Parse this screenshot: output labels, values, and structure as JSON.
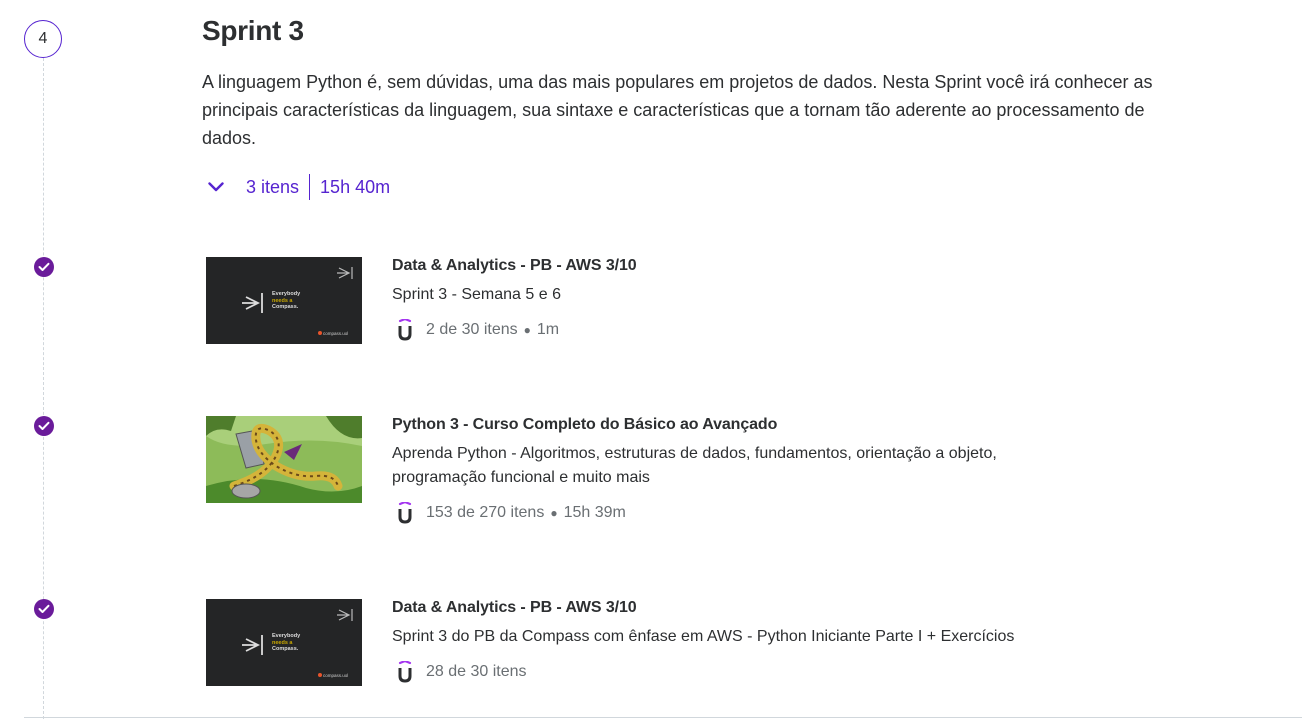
{
  "section": {
    "step_number": "4",
    "title": "Sprint 3",
    "description": "A linguagem Python é, sem dúvidas, uma das mais populares em projetos de dados. Nesta Sprint você irá conhecer as principais características da linguagem, sua sintaxe e características que a tornam tão aderente ao processamento de dados.",
    "item_count": "3 itens",
    "duration": "15h 40m"
  },
  "courses": [
    {
      "title": "Data & Analytics - PB - AWS 3/10",
      "subtitle": "Sprint 3 - Semana 5 e 6",
      "progress": "2 de 30 itens",
      "duration": "1m",
      "thumb_text": [
        "Everybody",
        "needs a",
        "Compass."
      ],
      "thumb_brand": "compass.uol"
    },
    {
      "title": "Python 3 - Curso Completo do Básico ao Avançado",
      "subtitle": "Aprenda Python - Algoritmos, estruturas de dados, fundamentos, orientação a objeto, programação funcional e muito mais",
      "progress": "153 de 270 itens",
      "duration": "15h 39m"
    },
    {
      "title": "Data & Analytics - PB - AWS 3/10",
      "subtitle": "Sprint 3 do PB da Compass com ênfase em AWS - Python Iniciante Parte I + Exercícios",
      "progress": "28 de 30 itens",
      "thumb_text": [
        "Everybody",
        "needs a",
        "Compass."
      ],
      "thumb_brand": "compass.uol"
    }
  ],
  "colors": {
    "accent": "#5624d0",
    "check": "#6a1b9a",
    "text": "#2d2f31",
    "muted": "#6a6f73"
  },
  "icons": {
    "expand": "chevron-down-icon",
    "complete": "check-circle-icon",
    "provider": "udemy-u-icon"
  }
}
